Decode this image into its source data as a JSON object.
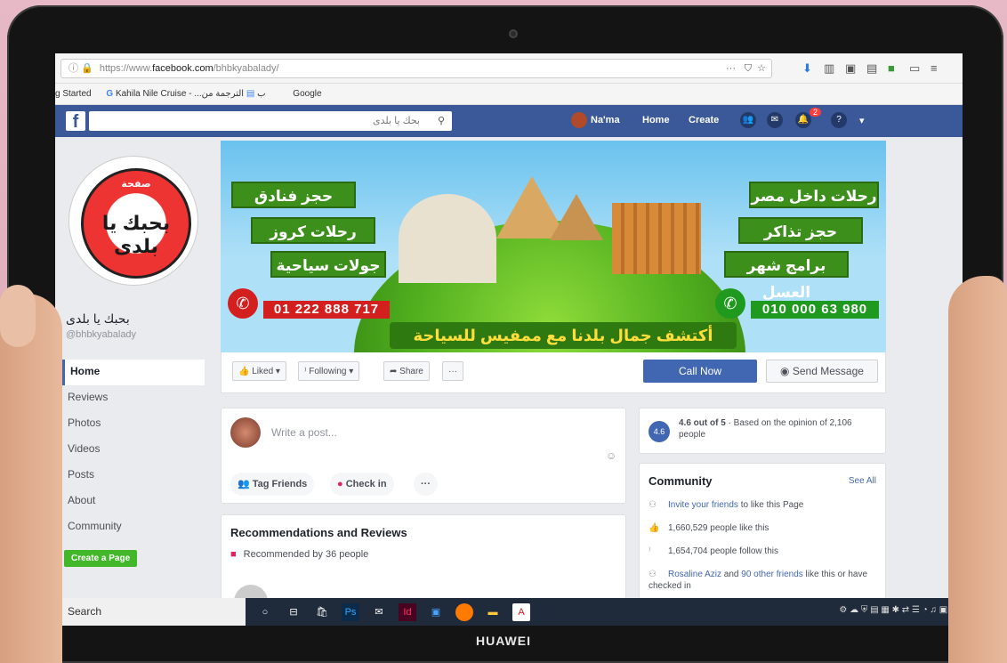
{
  "browser": {
    "url_prefix": "https://www.",
    "url_host": "facebook.com",
    "url_path": "/bhbkyabalady/",
    "bookmarks": [
      "g Started",
      "Kahila Nile Cruise - ...ب",
      "الترجمة من Google"
    ]
  },
  "fb_header": {
    "search_placeholder": "بحك يا بلدى",
    "user_name": "Na'ma",
    "nav_home": "Home",
    "nav_create": "Create",
    "notifications_count": "2"
  },
  "page": {
    "name": "بحبك يا بلدى",
    "handle": "@bhbkyabalady",
    "logo_top": "صفحة",
    "logo_text": "بحبك يا بلدى"
  },
  "left_nav": {
    "items": [
      "Home",
      "Reviews",
      "Photos",
      "Videos",
      "Posts",
      "About",
      "Community"
    ],
    "create_page": "Create a Page"
  },
  "cover": {
    "left_buttons": [
      "حجز فنادق",
      "رحلات كروز",
      "جولات سياحية"
    ],
    "right_buttons": [
      "رحلات داخل مصر",
      "حجز تذاكر طيران",
      "برامج شهر العسل"
    ],
    "left_phone": "01 222 888 717",
    "right_phone": "010 000 63 980",
    "tagline": "أكتشف جمال بلدنا مع ممفيس للسياحة"
  },
  "actions": {
    "liked": "Liked ▾",
    "following": "Following ▾",
    "share": "Share",
    "more": "···",
    "call_now": "Call Now",
    "send_message": "Send Message"
  },
  "composer": {
    "placeholder": "Write a post...",
    "tag_friends": "Tag Friends",
    "check_in": "Check in",
    "more": "···"
  },
  "recommendations": {
    "title": "Recommendations and Reviews",
    "recommended_by": "Recommended by 36 people"
  },
  "rating": {
    "badge": "4.6",
    "text_bold": "4.6 out of 5",
    "text_rest": " · Based on the opinion of 2,106 people"
  },
  "community": {
    "title": "Community",
    "see_all": "See All",
    "invite_link": "Invite your friends",
    "invite_rest": " to like this Page",
    "likes": "1,660,529 people like this",
    "follows": "1,654,704 people follow this",
    "friends_link": "Rosaline Aziz",
    "friends_mid": " and ",
    "friends_link2": "90 other friends",
    "friends_rest": " like this or have checked in"
  },
  "taskbar": {
    "search_text": "Search"
  },
  "device": {
    "brand": "HUAWEI"
  },
  "colors": {
    "facebook_blue": "#3b5998",
    "button_blue": "#4267b2",
    "cover_green": "#3d8f1b",
    "phone_red": "#d41f1f",
    "phone_green": "#1f9a1f"
  }
}
